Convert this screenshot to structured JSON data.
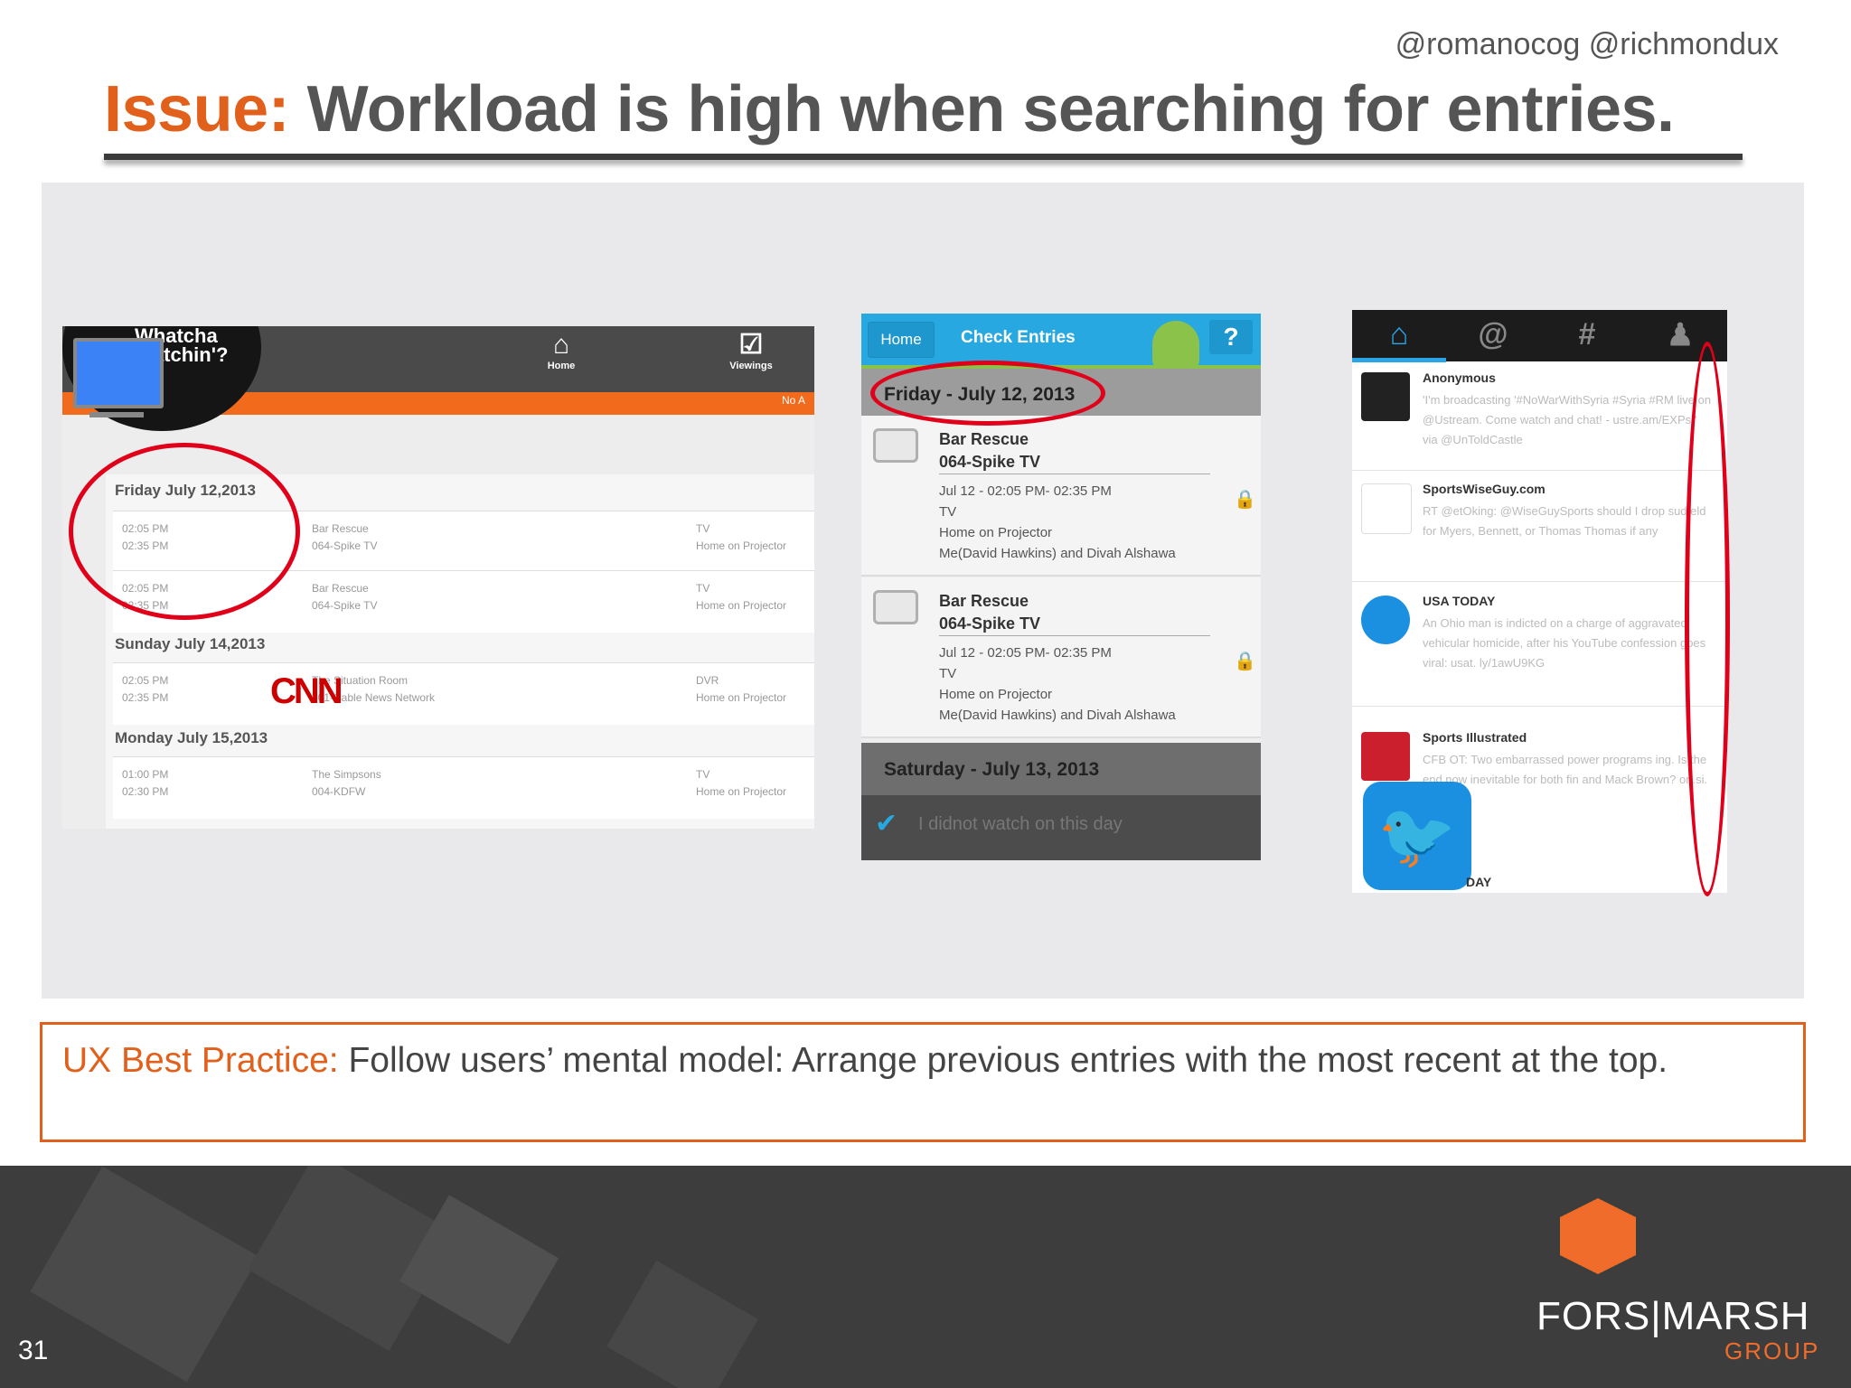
{
  "slide": {
    "handles": "@romanocog @richmondux",
    "title_keyword": "Issue:",
    "title_rest": " Workload is high when searching for entries.",
    "best_practice_keyword": "UX Best Practice:",
    "best_practice_rest": " Follow users’ mental model: Arrange previous entries with the most recent at the top.",
    "page_number": "31",
    "logo_main": "FORS|MARSH",
    "logo_sub": "GROUP"
  },
  "panel1": {
    "logo_text": "Whatcha\nWatchin'?",
    "nav_home": "Home",
    "nav_viewings": "Viewings",
    "corner": "No A",
    "groups": [
      {
        "date": "Friday July 12,2013",
        "rows": [
          {
            "time": "02:05 PM\n02:35 PM",
            "show": "Bar Rescue\n064-Spike TV",
            "detail": "TV\nHome on Projector"
          },
          {
            "time": "02:05 PM\n02:35 PM",
            "show": "Bar Rescue\n064-Spike TV",
            "detail": "TV\nHome on Projector"
          }
        ]
      },
      {
        "date": "Sunday July 14,2013",
        "rows": [
          {
            "time": "02:05 PM\n02:35 PM",
            "show": "The Situation Room\n301-Cable News Network",
            "detail": "DVR\nHome on Projector"
          }
        ]
      },
      {
        "date": "Monday July 15,2013",
        "rows": [
          {
            "time": "01:00 PM\n02:30 PM",
            "show": "The Simpsons\n004-KDFW",
            "detail": "TV\nHome on Projector"
          }
        ]
      }
    ],
    "cnn_logo": "CNN"
  },
  "panel2": {
    "home_button": "Home",
    "title": "Check Entries",
    "help_button": "?",
    "date1": "Friday - July 12, 2013",
    "entries": [
      {
        "name": "Bar Rescue\n064-Spike TV",
        "detail": "Jul 12 - 02:05 PM- 02:35 PM\nTV\nHome on Projector\nMe(David Hawkins) and Divah Alshawa"
      },
      {
        "name": "Bar Rescue\n064-Spike TV",
        "detail": "Jul 12 - 02:05 PM- 02:35 PM\nTV\nHome on Projector\nMe(David Hawkins) and Divah Alshawa"
      }
    ],
    "date2": "Saturday - July 13, 2013",
    "didnot": "I didnot watch on this day"
  },
  "panel3": {
    "tweets": [
      {
        "name": "Anonymous",
        "text": "'I'm broadcasting '#NoWarWithSyria #Syria #RM live on @Ustream. Come watch and chat! - ustre.am/EXPs ' via @UnToldCastle",
        "avatar_color": "#222222"
      },
      {
        "name": "SportsWiseGuy.com",
        "text": "RT @etOking: @WiseGuySports should I drop sudfeld for Myers, Bennett, or Thomas Thomas if any",
        "avatar_color": "#ffffff"
      },
      {
        "name": "USA TODAY",
        "text": "An Ohio man is indicted on a charge of aggravated vehicular homicide, after his YouTube confession goes viral: usat. ly/1awU9KG",
        "avatar_color": "#1b8fe0"
      },
      {
        "name": "Sports Illustrated",
        "text": "CFB OT: Two embarrassed power programs ing. Is the end now inevitable for both fin and Mack Brown? on.si. FPVsb",
        "avatar_color": "#cc1f2d"
      }
    ],
    "last_name": "DAY"
  },
  "colors": {
    "accent": "#e0601c",
    "circle": "#e0001a"
  }
}
